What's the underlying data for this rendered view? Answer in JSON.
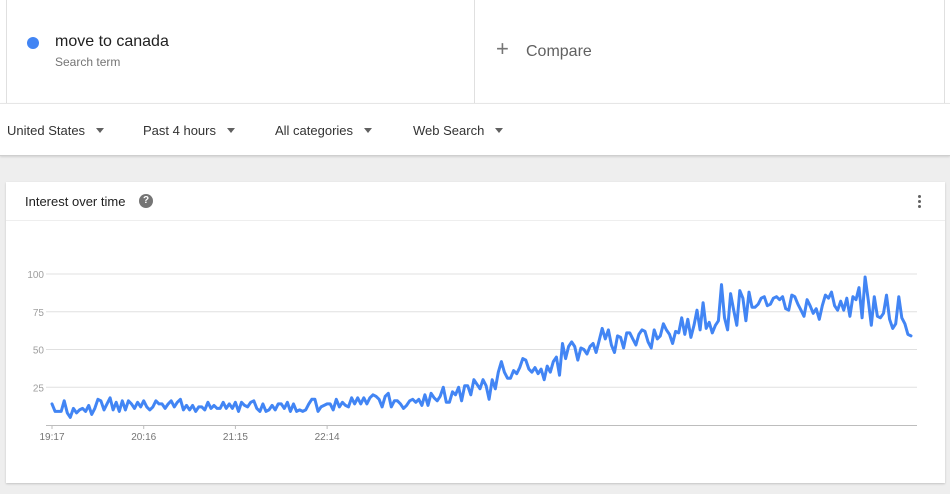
{
  "search_term": {
    "name": "move to canada",
    "subtitle": "Search term",
    "color": "#4285f4"
  },
  "compare": {
    "label": "Compare",
    "icon": "plus-icon"
  },
  "filters": {
    "region": "United States",
    "time": "Past 4 hours",
    "category": "All categories",
    "property": "Web Search"
  },
  "card": {
    "title": "Interest over time",
    "help_icon": "help-icon",
    "menu_icon": "more-vert-icon"
  },
  "chart_data": {
    "type": "line",
    "title": "Interest over time",
    "xlabel": "",
    "ylabel": "",
    "ylim": [
      0,
      100
    ],
    "yticks": [
      25,
      50,
      75,
      100
    ],
    "x_tick_labels": [
      "19:17",
      "20:16",
      "21:15",
      "22:14"
    ],
    "x_tick_index": [
      0,
      30,
      60,
      90
    ],
    "grid": true,
    "legend": "none",
    "series": [
      {
        "color": "#4285f4",
        "values": [
          14,
          9,
          9,
          9,
          16,
          8,
          5,
          11,
          8,
          10,
          11,
          9,
          13,
          7,
          11,
          17,
          16,
          10,
          14,
          18,
          10,
          15,
          9,
          16,
          10,
          16,
          14,
          11,
          15,
          12,
          16,
          12,
          10,
          12,
          16,
          14,
          14,
          11,
          14,
          16,
          12,
          15,
          17,
          10,
          13,
          10,
          13,
          9,
          12,
          12,
          10,
          15,
          11,
          13,
          11,
          11,
          15,
          11,
          14,
          11,
          15,
          9,
          15,
          13,
          12,
          15,
          16,
          11,
          9,
          14,
          9,
          10,
          13,
          10,
          14,
          14,
          11,
          15,
          9,
          14,
          9,
          10,
          9,
          10,
          14,
          17,
          17,
          9,
          12,
          13,
          14,
          14,
          10,
          17,
          12,
          15,
          13,
          12,
          18,
          14,
          18,
          14,
          18,
          14,
          18,
          20,
          19,
          17,
          12,
          19,
          21,
          12,
          16,
          16,
          14,
          11,
          13,
          16,
          17,
          15,
          17,
          13,
          20,
          13,
          21,
          18,
          16,
          19,
          25,
          15,
          15,
          22,
          20,
          25,
          16,
          26,
          26,
          20,
          30,
          27,
          24,
          30,
          26,
          17,
          30,
          24,
          35,
          42,
          35,
          31,
          31,
          36,
          34,
          38,
          44,
          43,
          37,
          35,
          38,
          34,
          37,
          30,
          39,
          35,
          42,
          45,
          33,
          54,
          44,
          52,
          55,
          52,
          43,
          51,
          50,
          47,
          52,
          54,
          48,
          56,
          64,
          57,
          63,
          53,
          48,
          59,
          58,
          51,
          61,
          61,
          57,
          53,
          60,
          63,
          62,
          55,
          51,
          63,
          57,
          59,
          67,
          63,
          60,
          54,
          62,
          61,
          71,
          60,
          70,
          58,
          66,
          76,
          63,
          81,
          64,
          68,
          61,
          66,
          69,
          93,
          71,
          63,
          87,
          76,
          66,
          89,
          84,
          69,
          88,
          78,
          78,
          80,
          84,
          85,
          79,
          80,
          84,
          85,
          83,
          85,
          77,
          76,
          86,
          85,
          80,
          76,
          72,
          83,
          79,
          74,
          77,
          70,
          79,
          86,
          84,
          88,
          79,
          76,
          82,
          76,
          84,
          72,
          85,
          83,
          91,
          71,
          98,
          83,
          66,
          85,
          72,
          71,
          74,
          86,
          70,
          64,
          67,
          85,
          71,
          67,
          60,
          59
        ]
      }
    ]
  }
}
